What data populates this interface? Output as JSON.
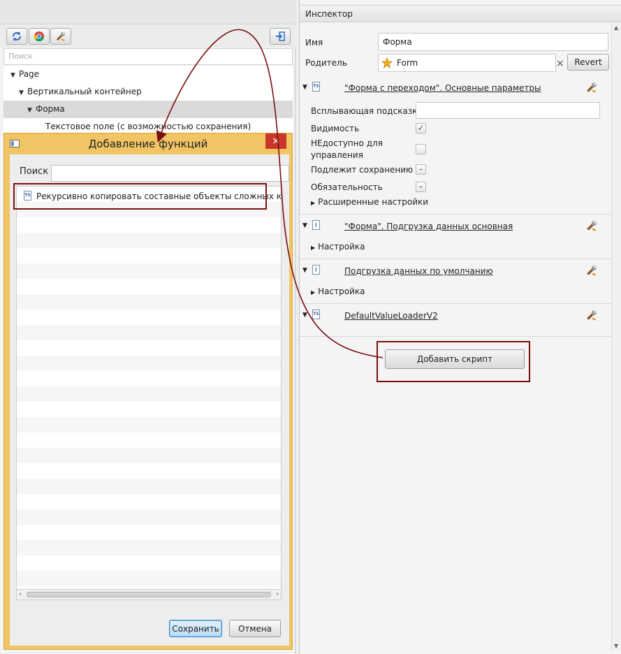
{
  "left": {
    "search_placeholder": "Поиск",
    "tree": [
      {
        "label": "Page",
        "depth": 0
      },
      {
        "label": "Вертикальный контейнер",
        "depth": 1
      },
      {
        "label": "Форма",
        "depth": 2
      },
      {
        "label": "Текстовое поле (с возможностью сохранения)",
        "depth": 3
      }
    ]
  },
  "dialog": {
    "title": "Добавление функций",
    "close_glyph": "×",
    "search_label": "Поиск",
    "search_value": "",
    "items": [
      {
        "icon": "ts-file-icon",
        "label": "Рекурсивно копировать составные объекты сложных компонен"
      }
    ],
    "save_label": "Сохранить",
    "cancel_label": "Отмена"
  },
  "inspector": {
    "title": "Инспектор",
    "name_label": "Имя",
    "name_value": "Форма",
    "parent_label": "Родитель",
    "parent_value": "Form",
    "clear_glyph": "×",
    "revert_label": "Revert",
    "sections": [
      {
        "icon": "ts-file-icon",
        "title": "\"Форма с переходом\". Основные параметры"
      },
      {
        "icon": "js-file-icon",
        "title": "\"Форма\". Подгрузка данных основная"
      },
      {
        "icon": "js-file-icon",
        "title": "Подгрузка данных по умолчанию"
      },
      {
        "icon": "ts-file-icon",
        "title": "DefaultValueLoaderV2"
      }
    ],
    "props": {
      "tooltip_label": "Всплывающая подсказка",
      "tooltip_value": "",
      "visible_label": "Видимость",
      "visible": true,
      "disabled_label_1": "НЕдоступно для",
      "disabled_label_2": "управления",
      "disabled": false,
      "saveable_label": "Подлежит сохранению",
      "required_label": "Обязательность"
    },
    "advanced_label": "Расширенные настройки",
    "settings_label": "Настройка",
    "add_script_label": "Добавить скрипт"
  },
  "icon_names": [
    "refresh-icon",
    "chrome-icon",
    "tools-icon",
    "exit-icon",
    "star-icon",
    "wrench-icon"
  ],
  "colors": {
    "dialog_frame": "#f1c464",
    "close_red": "#c9362a",
    "annotation": "#7a0e0e",
    "primary_button": "#3b8fd4"
  }
}
